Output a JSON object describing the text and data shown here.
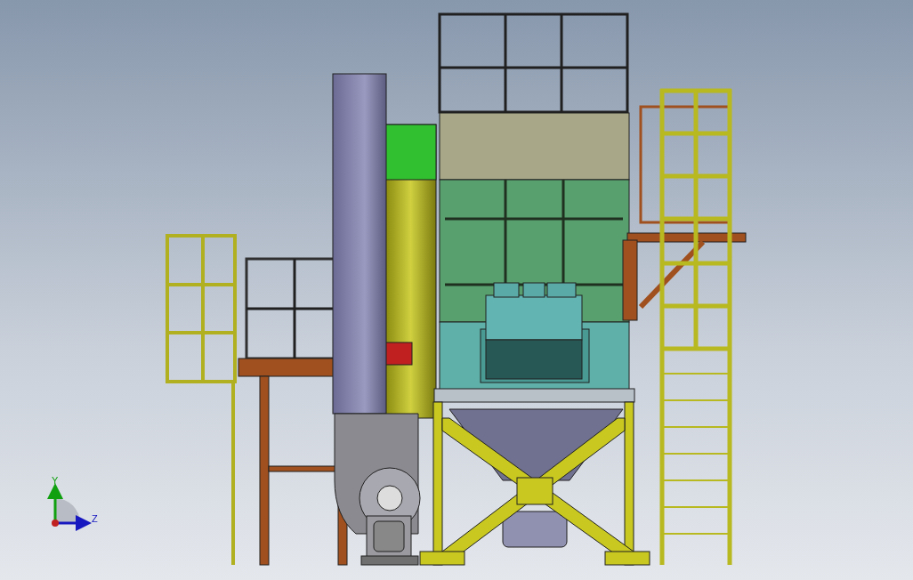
{
  "viewport": {
    "triad": {
      "y_label": "Y",
      "z_label": "Z"
    }
  }
}
